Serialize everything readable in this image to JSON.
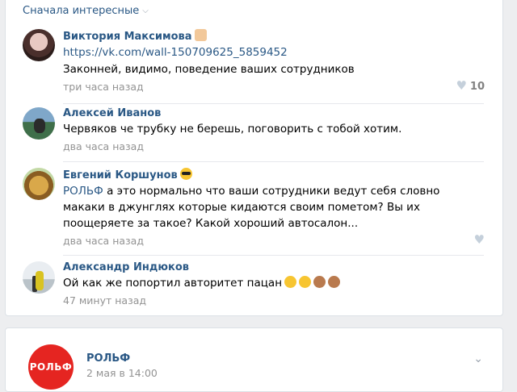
{
  "sort": {
    "label": "Сначала интересные"
  },
  "comments": [
    {
      "author": "Виктория Максимова",
      "link": "https://vk.com/wall-150709625_5859452",
      "text": "Законней, видимо, поведение ваших сотрудников",
      "time": "три часа назад",
      "likes": "10"
    },
    {
      "author": "Алексей Иванов",
      "text": "Червяков че трубку не берешь, поговорить с тобой хотим.",
      "time": "два часа назад"
    },
    {
      "author": "Евгений Коршунов",
      "mention": "РОЛЬФ",
      "text": " а это нормально что ваши сотрудники ведут себя словно макаки в джунглях которые кидаются своим пометом? Вы их поощеряете за такое? Какой хороший автосалон...",
      "time": "два часа назад"
    },
    {
      "author": "Александр Индюков",
      "text": "Ой как же попортил авторитет пацан",
      "time": "47 минут назад"
    }
  ],
  "post": {
    "logo_text": "РОЛЬФ",
    "name": "РОЛЬФ",
    "date": "2 мая в 14:00"
  },
  "icons": {
    "heart": "heart-icon",
    "chevron": "chevron-down-icon"
  },
  "colors": {
    "link": "#2a5885",
    "meta": "#939393",
    "brand": "#e52521",
    "background": "#edeef0"
  }
}
